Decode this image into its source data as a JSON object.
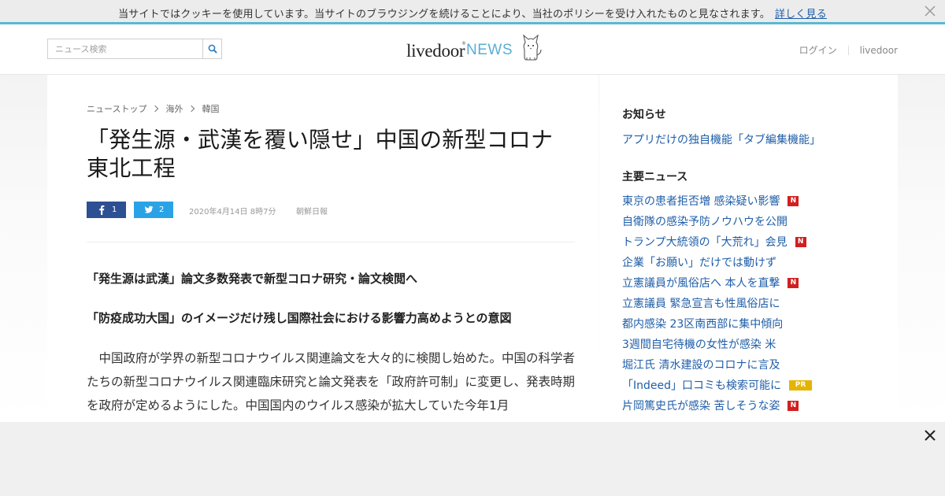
{
  "cookie_bar": {
    "text": "当サイトではクッキーを使用しています。当サイトのブラウジングを続けることにより、当社のポリシーを受け入れたものと見なされます。",
    "link": "詳しく見る",
    "close_icon": "close-icon"
  },
  "header": {
    "search_placeholder": "ニュース検索",
    "search_icon": "search-icon",
    "logo": {
      "brand": "livedoor",
      "mark": "®",
      "product": "NEWS"
    },
    "nav": {
      "login": "ログイン",
      "livedoor": "livedoor"
    }
  },
  "article": {
    "breadcrumb": [
      "ニューストップ",
      "海外",
      "韓国"
    ],
    "title": "「発生源・武漢を覆い隠せ」中国の新型コロナ東北工程",
    "share": {
      "facebook_count": "1",
      "twitter_count": "2"
    },
    "date": "2020年4月14日 8時7分",
    "source": "朝鮮日報",
    "subheads": [
      "「発生源は武漢」論文多数発表で新型コロナ研究・論文検閲へ",
      "「防疫成功大国」のイメージだけ残し国際社会における影響力高めようとの意図"
    ],
    "body": "中国政府が学界の新型コロナウイルス関連論文を大々的に検閲し始めた。中国の科学者たちの新型コロナウイルス関連臨床研究と論文発表を「政府許可制」に変更し、発表時期を政府が定めるようにした。中国国内のウイルス感染が拡大していた今年1月"
  },
  "sidebar": {
    "notice_heading": "お知らせ",
    "notice_link": "アプリだけの独自機能「タブ編集機能」",
    "news_heading": "主要ニュース",
    "news": [
      {
        "text": "東京の患者拒否増 感染疑い影響",
        "badge": "N"
      },
      {
        "text": "自衛隊の感染予防ノウハウを公開",
        "badge": ""
      },
      {
        "text": "トランプ大統領の「大荒れ」会見",
        "badge": "N"
      },
      {
        "text": "企業「お願い」だけでは動けず",
        "badge": ""
      },
      {
        "text": "立憲議員が風俗店へ 本人を直撃",
        "badge": "N"
      },
      {
        "text": "立憲議員 緊急宣言も性風俗店に",
        "badge": ""
      },
      {
        "text": "都内感染 23区南西部に集中傾向",
        "badge": ""
      },
      {
        "text": "3週間自宅待機の女性が感染 米",
        "badge": ""
      },
      {
        "text": "堀江氏 清水建設のコロナに言及",
        "badge": ""
      },
      {
        "text": "「Indeed」口コミも検索可能に",
        "badge": "PR"
      },
      {
        "text": "片岡篤史氏が感染 苦しそうな姿",
        "badge": "N"
      }
    ]
  },
  "ad_overlay": {
    "close_icon": "close-icon"
  },
  "colors": {
    "accent_bar": "#5bb8cf",
    "link": "#1f5ea8",
    "facebook": "#2d4f93",
    "twitter": "#2aa3e6",
    "badge_new": "#d1201f",
    "badge_pr": "#e5b400",
    "logo_news": "#5aaed6"
  }
}
